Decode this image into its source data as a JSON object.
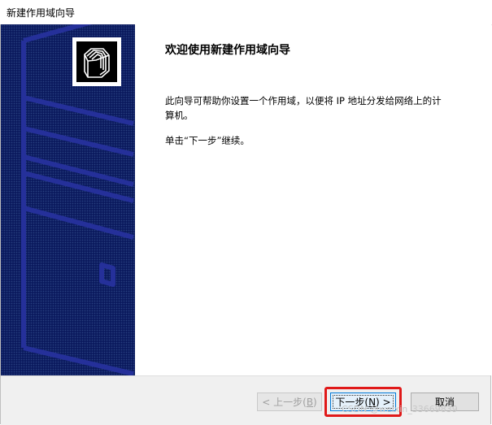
{
  "window": {
    "title": "新建作用域向导"
  },
  "content": {
    "heading": "欢迎使用新建作用域向导",
    "description": "此向导可帮助你设置一个作用域，以便将 IP 地址分发给网络上的计算机。",
    "hint": "单击“下一步”继续。"
  },
  "buttons": {
    "back": {
      "prefix": "< 上一步(",
      "key": "B",
      "suffix": ")"
    },
    "next": {
      "prefix": "下一步(",
      "key": "N",
      "suffix": ") >"
    },
    "cancel": "取消"
  },
  "icons": {
    "wizard": "folder-stack-icon"
  },
  "colors": {
    "side_panel": "#0b1a5e",
    "highlight": "#e01919",
    "next_border": "#0078d7"
  },
  "watermark": "CSDN @weixin_33669839"
}
